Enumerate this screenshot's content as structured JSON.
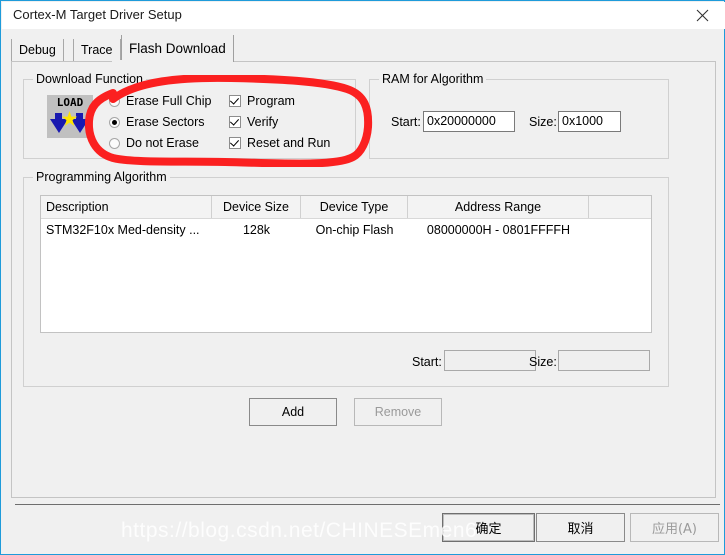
{
  "window": {
    "title": "Cortex-M Target Driver Setup",
    "close_icon": "close-icon",
    "accent": "#1e9bda",
    "bg": "#f0f0f0"
  },
  "tabs": [
    {
      "label": "Debug",
      "active": false
    },
    {
      "label": "Trace",
      "active": false
    },
    {
      "label": "Flash Download",
      "active": true
    }
  ],
  "download_function": {
    "title": "Download Function",
    "icon": "load-icon",
    "icon_text": "LOAD",
    "erase_options": [
      {
        "label": "Erase Full Chip",
        "selected": false
      },
      {
        "label": "Erase Sectors",
        "selected": true
      },
      {
        "label": "Do not Erase",
        "selected": false
      }
    ],
    "checkboxes": [
      {
        "label": "Program",
        "checked": true
      },
      {
        "label": "Verify",
        "checked": true
      },
      {
        "label": "Reset and Run",
        "checked": true
      }
    ]
  },
  "ram_for_algorithm": {
    "title": "RAM for Algorithm",
    "start_label": "Start:",
    "start_value": "0x20000000",
    "size_label": "Size:",
    "size_value": "0x1000"
  },
  "programming_algorithm": {
    "title": "Programming Algorithm",
    "columns": [
      "Description",
      "Device Size",
      "Device Type",
      "Address Range",
      ""
    ],
    "rows": [
      {
        "description": "STM32F10x Med-density ...",
        "device_size": "128k",
        "device_type": "On-chip Flash",
        "address_range": "08000000H - 0801FFFFH"
      }
    ],
    "start_label": "Start:",
    "start_value": "",
    "size_label": "Size:",
    "size_value": "",
    "add_button": "Add",
    "remove_button": "Remove"
  },
  "footer": {
    "ok_button": "确定",
    "cancel_button": "取消",
    "apply_button": "应用(A)"
  },
  "annotation": {
    "color": "#fb2020",
    "shape": "hand-drawn-ellipse"
  },
  "watermark": {
    "text": "https://blog.csdn.net/CHINESEmen6"
  }
}
